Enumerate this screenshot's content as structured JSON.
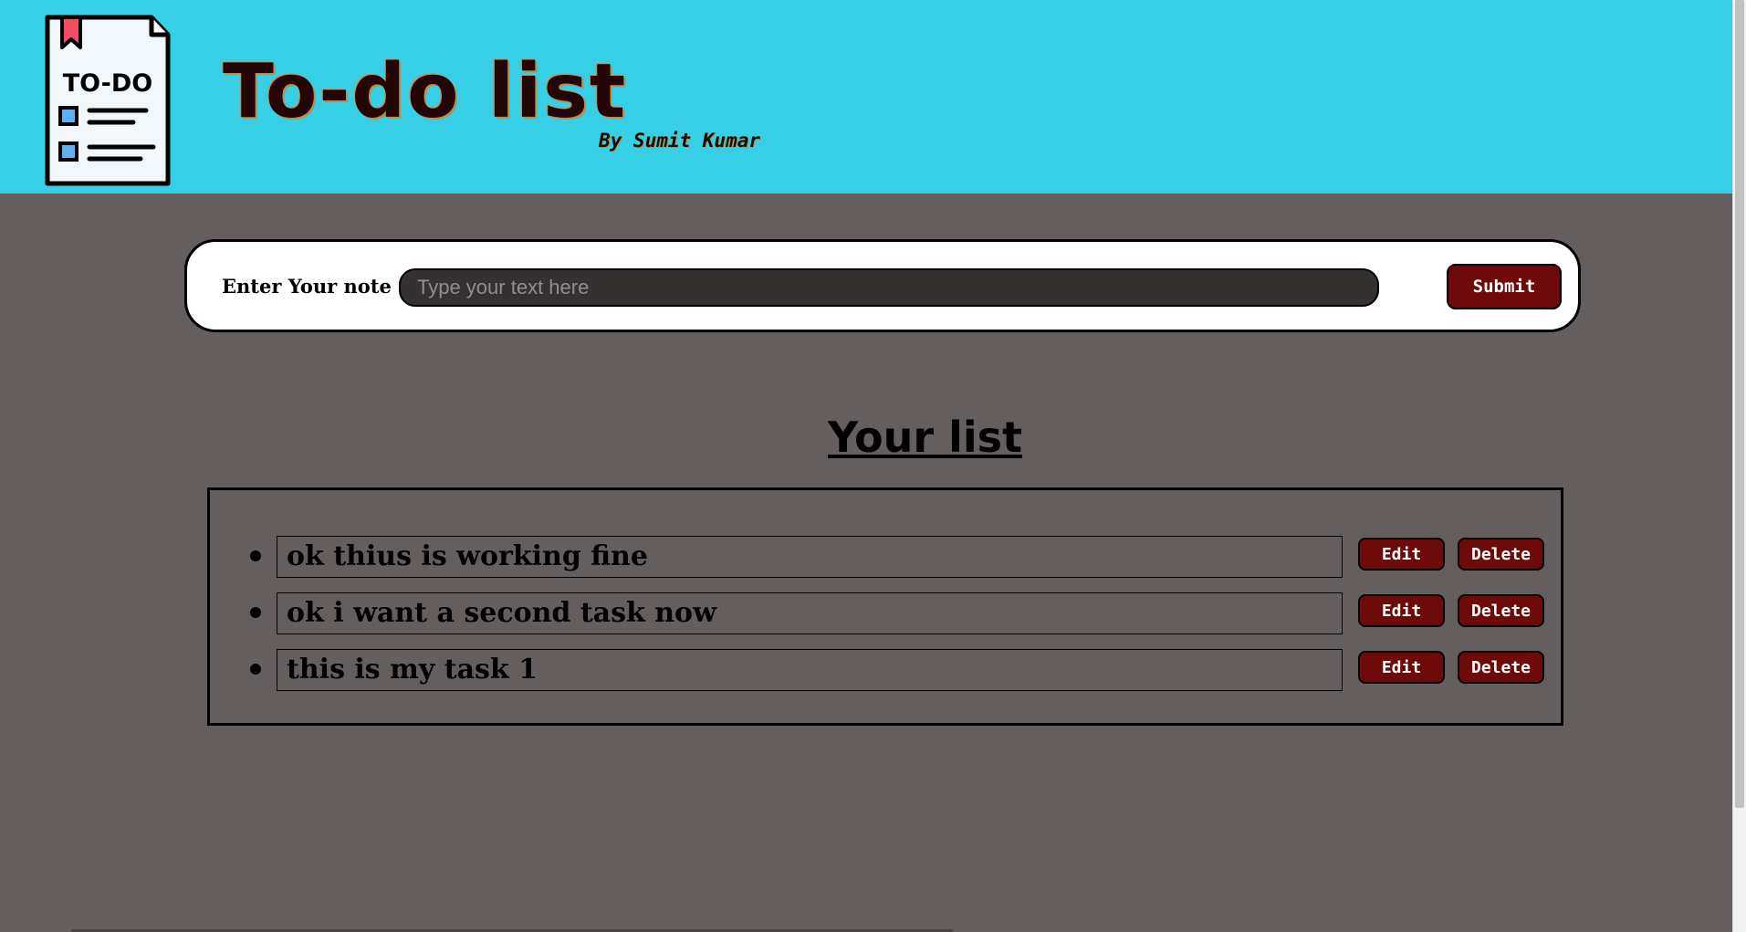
{
  "header": {
    "title": "To-do list",
    "author": "By Sumit Kumar",
    "logo_text": "TO-DO",
    "background": "#36cfe6"
  },
  "form": {
    "label": "Enter Your note :",
    "placeholder": "Type your text here",
    "value": "",
    "submit_label": "Submit"
  },
  "list": {
    "title": "Your list",
    "tasks": [
      {
        "text": "ok thius is working fine",
        "edit_label": "Edit",
        "delete_label": "Delete"
      },
      {
        "text": "ok i want a second task now",
        "edit_label": "Edit",
        "delete_label": "Delete"
      },
      {
        "text": "this is my task 1",
        "edit_label": "Edit",
        "delete_label": "Delete"
      }
    ]
  },
  "colors": {
    "page_bg": "#655e5e",
    "button_bg": "#6e0a0a",
    "input_bg": "#353131"
  }
}
